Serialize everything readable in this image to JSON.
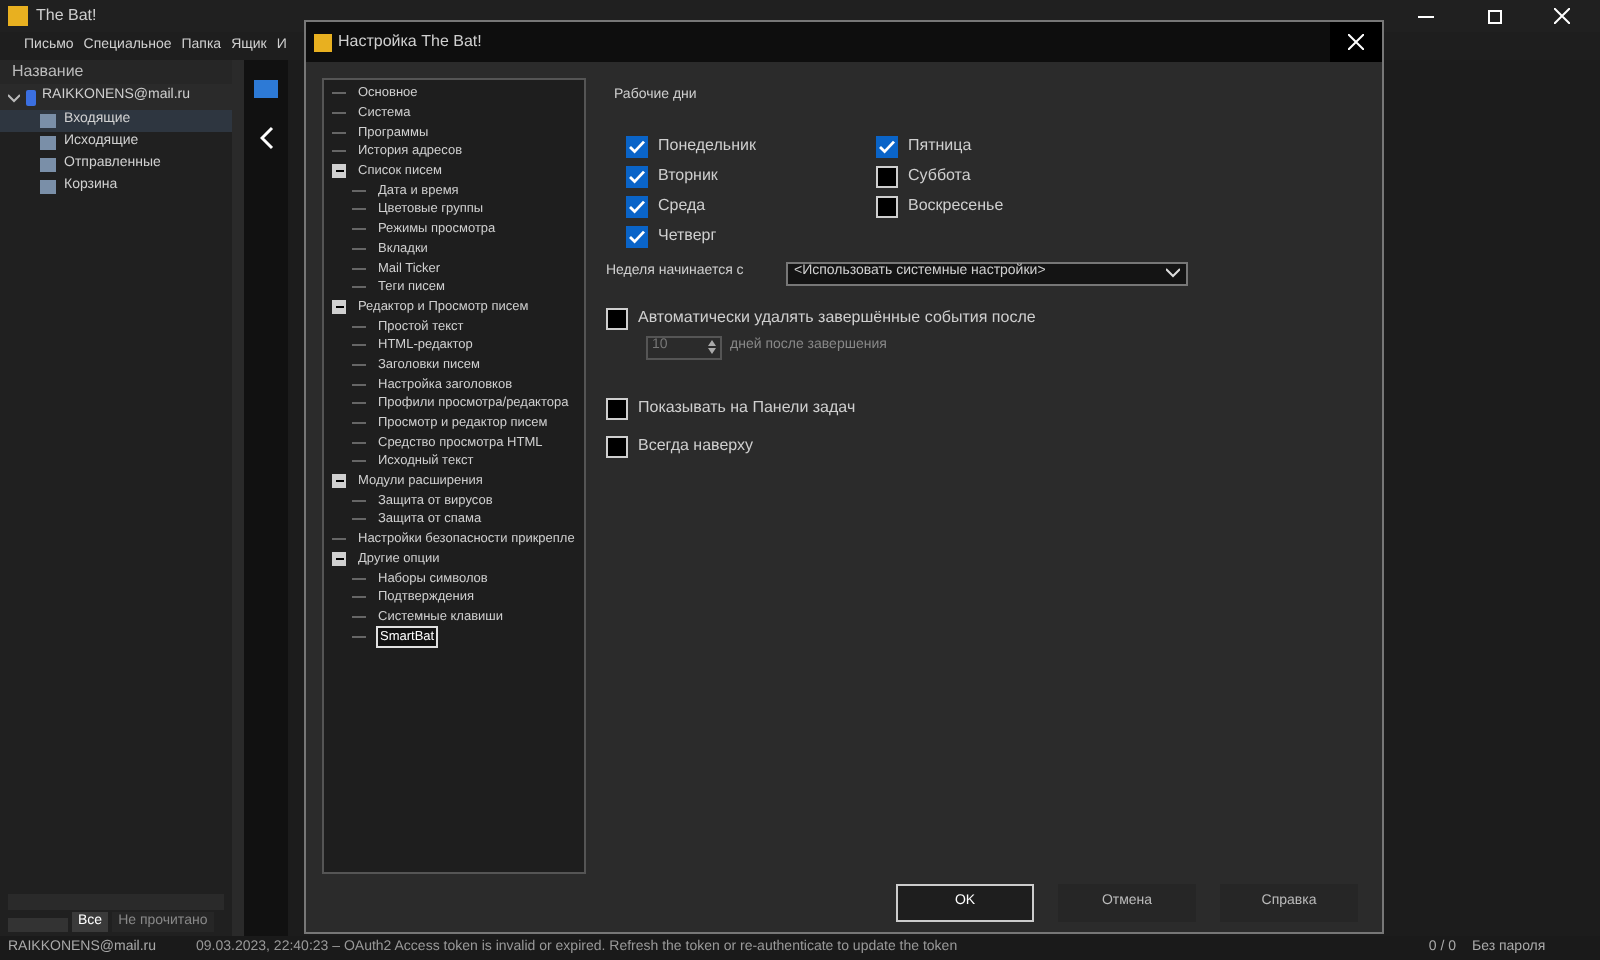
{
  "app": {
    "title": "The Bat!",
    "menu": [
      "Письмо",
      "Специальное",
      "Папка",
      "Ящик",
      "И"
    ],
    "folder_header": "Название",
    "account": {
      "name": "RAIKKONENS@mail.ru",
      "expanded": true,
      "folders": [
        {
          "name": "Входящие",
          "selected": true
        },
        {
          "name": "Исходящие",
          "selected": false
        },
        {
          "name": "Отправленные",
          "selected": false
        },
        {
          "name": "Корзина",
          "selected": false
        }
      ]
    },
    "view_tabs": [
      {
        "label": "Все",
        "selected": true
      },
      {
        "label": "Не прочитано",
        "selected": false
      }
    ],
    "status_bar": {
      "account": "RAIKKONENS@mail.ru",
      "message": "09.03.2023, 22:40:23 – OAuth2 Access token is invalid or expired. Refresh the token or re-authenticate to update the token",
      "count": "0 / 0",
      "security": "Без пароля"
    }
  },
  "dialog": {
    "title": "Настройка The Bat!",
    "tree": [
      {
        "label": "Основное",
        "selected": false
      },
      {
        "label": "Система",
        "selected": false
      },
      {
        "label": "Программы",
        "selected": false
      },
      {
        "label": "История адресов",
        "selected": false
      },
      {
        "label": "Список писем",
        "selected": false,
        "expanded": true,
        "children": [
          {
            "label": "Дата и время",
            "selected": false
          },
          {
            "label": "Цветовые группы",
            "selected": false
          },
          {
            "label": "Режимы просмотра",
            "selected": false
          },
          {
            "label": "Вкладки",
            "selected": false
          },
          {
            "label": "Mail Ticker",
            "selected": false
          },
          {
            "label": "Теги писем",
            "selected": false
          }
        ]
      },
      {
        "label": "Редактор и Просмотр писем",
        "selected": false,
        "expanded": true,
        "children": [
          {
            "label": "Простой текст",
            "selected": false
          },
          {
            "label": "HTML-редактор",
            "selected": false
          },
          {
            "label": "Заголовки писем",
            "selected": false
          },
          {
            "label": "Настройка заголовков",
            "selected": false
          },
          {
            "label": "Профили просмотра/редактора",
            "selected": false
          },
          {
            "label": "Просмотр и редактор писем",
            "selected": false
          },
          {
            "label": "Средство просмотра HTML",
            "selected": false
          },
          {
            "label": "Исходный текст",
            "selected": false
          }
        ]
      },
      {
        "label": "Модули расширения",
        "selected": false,
        "expanded": true,
        "children": [
          {
            "label": "Защита от вирусов",
            "selected": false
          },
          {
            "label": "Защита от спама",
            "selected": false
          }
        ]
      },
      {
        "label": "Настройки безопасности прикрепле",
        "selected": false
      },
      {
        "label": "Другие опции",
        "selected": false,
        "expanded": true,
        "children": [
          {
            "label": "Наборы символов",
            "selected": false
          },
          {
            "label": "Подтверждения",
            "selected": false
          },
          {
            "label": "Системные клавиши",
            "selected": false
          },
          {
            "label": "SmartBat",
            "selected": true
          }
        ]
      }
    ],
    "workdays_label": "Рабочие дни",
    "workdays": [
      {
        "label": "Понедельник",
        "checked": true
      },
      {
        "label": "Вторник",
        "checked": true
      },
      {
        "label": "Среда",
        "checked": true
      },
      {
        "label": "Четверг",
        "checked": true
      },
      {
        "label": "Пятница",
        "checked": true
      },
      {
        "label": "Суббота",
        "checked": false
      },
      {
        "label": "Воскресенье",
        "checked": false
      }
    ],
    "week_start": {
      "label": "Неделя начинается с",
      "value": "<Использовать системные настройки>"
    },
    "auto_delete": {
      "label": "Автоматически удалять завершённые события после",
      "checked": false,
      "days": "10",
      "days_label": "дней после завершения"
    },
    "options": [
      {
        "label": "Показывать на Панели задач",
        "checked": false
      },
      {
        "label": "Всегда наверху",
        "checked": false
      }
    ],
    "buttons": [
      {
        "label": "OK",
        "default": true
      },
      {
        "label": "Отмена",
        "default": false
      },
      {
        "label": "Справка",
        "default": false
      }
    ]
  }
}
